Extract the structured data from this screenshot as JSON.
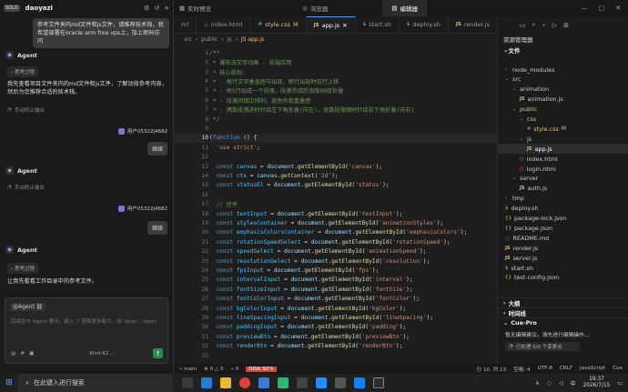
{
  "chat": {
    "badge": "SOLO",
    "user": "daoyazi",
    "user_msg_1": "参考文件夹内md文件和js文件，请推荐技术栈，我希望部署在oracle arm free vps上，加上密码访问",
    "agent_label": "Agent",
    "think_label": "思考过程",
    "agent_text_1": "我先查看项目文件夹内的md文件和js文件，了解动效参考内容，然后为您推荐合适的技术栈。",
    "stop_label": "手动终止输出",
    "user_name": "用户05322J4682",
    "continue_label": "继续",
    "agent_text_3": "让我先看看工作目录中的参考文件。",
    "input_tag": "@Agent",
    "input_placeholder": "后续在与 Agent 聊天。输入 '/' 获取更多能力，如 '/plan', '/spec'",
    "model_label": "Kimi-K2...",
    "send_icon": "send-icon"
  },
  "topbar": {
    "tabs": [
      "实时预览",
      "浏览器",
      "编辑器"
    ],
    "active": "编辑器"
  },
  "editor": {
    "tabs": [
      {
        "label": "ml",
        "type": ""
      },
      {
        "label": "index.html",
        "type": "html"
      },
      {
        "label": "style.css",
        "type": "css",
        "badge": "M"
      },
      {
        "label": "app.js",
        "type": "js",
        "active": true
      },
      {
        "label": "start.sh",
        "type": "sh"
      },
      {
        "label": "deploy.sh",
        "type": "sh"
      },
      {
        "label": "render.js",
        "type": "js"
      }
    ],
    "breadcrumb": [
      "src",
      "public",
      "js",
      "JS app.js"
    ],
    "lines": [
      {
        "n": "1",
        "html": "<span class='cm'>/**</span>"
      },
      {
        "n": "2",
        "html": "<span class='cm'> * 瀑布流文字动画 - 前端应用</span>"
      },
      {
        "n": "3",
        "html": "<span class='cm'> * 核心规则:</span>"
      },
      {
        "n": "4",
        "html": "<span class='cm'> * - 每行文字垂直居中出现，新行出现时旧行上移</span>"
      },
      {
        "n": "5",
        "html": "<span class='cm'> * - 每5行组成一个段落，段落完成后渐隐90度折叠</span>"
      },
      {
        "n": "6",
        "html": "<span class='cm'> * - 段落间错位排列，避免外观重叠感</span>"
      },
      {
        "n": "7",
        "html": "<span class='cm'> * - 偶数段落进时针绕左下角折叠(向左)，奇数段落顺时针绕右下角折叠(向右)</span>"
      },
      {
        "n": "8",
        "html": "<span class='cm'> */</span>"
      },
      {
        "n": "9",
        "html": ""
      },
      {
        "n": "10",
        "html": "(<span class='kw2'>function</span> () {",
        "cur": true
      },
      {
        "n": "11",
        "html": "  <span class='str'>'use strict'</span>;"
      },
      {
        "n": "12",
        "html": ""
      },
      {
        "n": "13",
        "html": "  <span class='kw2'>const</span> <span class='cn'>canvas</span> = <span class='var'>document</span>.<span class='fn'>getElementById</span>(<span class='str'>'canvas'</span>);"
      },
      {
        "n": "14",
        "html": "  <span class='kw2'>const</span> <span class='cn'>ctx</span> = <span class='var'>canvas</span>.<span class='fn'>getContext</span>(<span class='str'>'2d'</span>);"
      },
      {
        "n": "15",
        "html": "  <span class='kw2'>const</span> <span class='cn'>statusEl</span> = <span class='var'>document</span>.<span class='fn'>getElementById</span>(<span class='str'>'status'</span>);"
      },
      {
        "n": "16",
        "html": ""
      },
      {
        "n": "17",
        "html": "  <span class='cm'>// 控件</span>"
      },
      {
        "n": "18",
        "html": "  <span class='kw2'>const</span> <span class='cn'>textInput</span> = <span class='var'>document</span>.<span class='fn'>getElementById</span>(<span class='str'>'textInput'</span>);"
      },
      {
        "n": "19",
        "html": "  <span class='kw2'>const</span> <span class='cn'>stylesContainer</span> = <span class='var'>document</span>.<span class='fn'>getElementById</span>(<span class='str'>'animationStyles'</span>);"
      },
      {
        "n": "20",
        "html": "  <span class='kw2'>const</span> <span class='cn'>emphasisColorsContainer</span> = <span class='var'>document</span>.<span class='fn'>getElementById</span>(<span class='str'>'emphasisColors'</span>);"
      },
      {
        "n": "21",
        "html": "  <span class='kw2'>const</span> <span class='cn'>rotationSpeedSelect</span> = <span class='var'>document</span>.<span class='fn'>getElementById</span>(<span class='str'>'rotationSpeed'</span>);"
      },
      {
        "n": "22",
        "html": "  <span class='kw2'>const</span> <span class='cn'>speedSelect</span> = <span class='var'>document</span>.<span class='fn'>getElementById</span>(<span class='str'>'animationSpeed'</span>);"
      },
      {
        "n": "23",
        "html": "  <span class='kw2'>const</span> <span class='cn'>resolutionSelect</span> = <span class='var'>document</span>.<span class='fn'>getElementById</span>(<span class='str'>'resolution'</span>);"
      },
      {
        "n": "24",
        "html": "  <span class='kw2'>const</span> <span class='cn'>fpsInput</span> = <span class='var'>document</span>.<span class='fn'>getElementById</span>(<span class='str'>'fps'</span>);"
      },
      {
        "n": "25",
        "html": "  <span class='kw2'>const</span> <span class='cn'>intervalInput</span> = <span class='var'>document</span>.<span class='fn'>getElementById</span>(<span class='str'>'interval'</span>);"
      },
      {
        "n": "26",
        "html": "  <span class='kw2'>const</span> <span class='cn'>fontSizeInput</span> = <span class='var'>document</span>.<span class='fn'>getElementById</span>(<span class='str'>'fontSize'</span>);"
      },
      {
        "n": "27",
        "html": "  <span class='kw2'>const</span> <span class='cn'>fontColorInput</span> = <span class='var'>document</span>.<span class='fn'>getElementById</span>(<span class='str'>'fontColor'</span>);"
      },
      {
        "n": "28",
        "html": "  <span class='kw2'>const</span> <span class='cn'>bgColorInput</span> = <span class='var'>document</span>.<span class='fn'>getElementById</span>(<span class='str'>'bgColor'</span>);"
      },
      {
        "n": "29",
        "html": "  <span class='kw2'>const</span> <span class='cn'>lineSpacingInput</span> = <span class='var'>document</span>.<span class='fn'>getElementById</span>(<span class='str'>'lineSpacing'</span>);"
      },
      {
        "n": "30",
        "html": "  <span class='kw2'>const</span> <span class='cn'>paddingInput</span> = <span class='var'>document</span>.<span class='fn'>getElementById</span>(<span class='str'>'padding'</span>);"
      },
      {
        "n": "31",
        "html": "  <span class='kw2'>const</span> <span class='cn'>previewBtn</span> = <span class='var'>document</span>.<span class='fn'>getElementById</span>(<span class='str'>'previewBtn'</span>);"
      },
      {
        "n": "32",
        "html": "  <span class='kw2'>const</span> <span class='cn'>renderBtn</span> = <span class='var'>document</span>.<span class='fn'>getElementById</span>(<span class='str'>'renderBtn'</span>);"
      },
      {
        "n": "33",
        "html": ""
      }
    ]
  },
  "explorer": {
    "title": "资源管理器",
    "root": "文件",
    "items": [
      {
        "label": "node_modules",
        "kind": "folder",
        "depth": 0,
        "arrow": "›"
      },
      {
        "label": "src",
        "kind": "folder",
        "depth": 0,
        "arrow": "⌄",
        "orange": true
      },
      {
        "label": "animation",
        "kind": "folder",
        "depth": 1,
        "arrow": "⌄"
      },
      {
        "label": "animation.js",
        "kind": "js",
        "depth": 2
      },
      {
        "label": "public",
        "kind": "folder",
        "depth": 1,
        "arrow": "⌄",
        "orange": true
      },
      {
        "label": "css",
        "kind": "folder",
        "depth": 2,
        "arrow": "⌄",
        "orange": true
      },
      {
        "label": "style.css",
        "kind": "css",
        "depth": 3,
        "badge": "M",
        "orange": true
      },
      {
        "label": "js",
        "kind": "folder",
        "depth": 2,
        "arrow": "⌄"
      },
      {
        "label": "app.js",
        "kind": "js",
        "depth": 3,
        "selected": true
      },
      {
        "label": "index.html",
        "kind": "html",
        "depth": 2
      },
      {
        "label": "login.html",
        "kind": "html",
        "depth": 2
      },
      {
        "label": "server",
        "kind": "folder",
        "depth": 1,
        "arrow": "⌄"
      },
      {
        "label": "auth.js",
        "kind": "js",
        "depth": 2
      },
      {
        "label": "tmp",
        "kind": "folder",
        "depth": 0,
        "arrow": "›"
      },
      {
        "label": "deploy.sh",
        "kind": "sh",
        "depth": 0
      },
      {
        "label": "package-lock.json",
        "kind": "json",
        "depth": 0
      },
      {
        "label": "package.json",
        "kind": "json",
        "depth": 0
      },
      {
        "label": "README.md",
        "kind": "md",
        "depth": 0
      },
      {
        "label": "render.js",
        "kind": "js",
        "depth": 0
      },
      {
        "label": "server.js",
        "kind": "js",
        "depth": 0
      },
      {
        "label": "start.sh",
        "kind": "sh",
        "depth": 0
      },
      {
        "label": "test-config.json",
        "kind": "json",
        "depth": 0
      }
    ],
    "outline": "大纲",
    "timeline": "时间线",
    "cue": "Cue-Pro",
    "cue_text": "暂无编辑建议。请先进行编辑操作...",
    "cue_box": "已处理 0/0 个变更点"
  },
  "status": {
    "branch": "main",
    "errors": "⊗ 0 △ 0",
    "ports": "0",
    "disk": "DISK 92%",
    "position": "行 10, 列 13",
    "spaces": "空格: 4",
    "encoding": "UTF-8",
    "eol": "CRLF",
    "language": "JavaScript",
    "cue": "Cue"
  },
  "taskbar": {
    "search": "在此键入进行搜索",
    "time": "19:37",
    "date": "2026/7/15",
    "lang": "中"
  }
}
